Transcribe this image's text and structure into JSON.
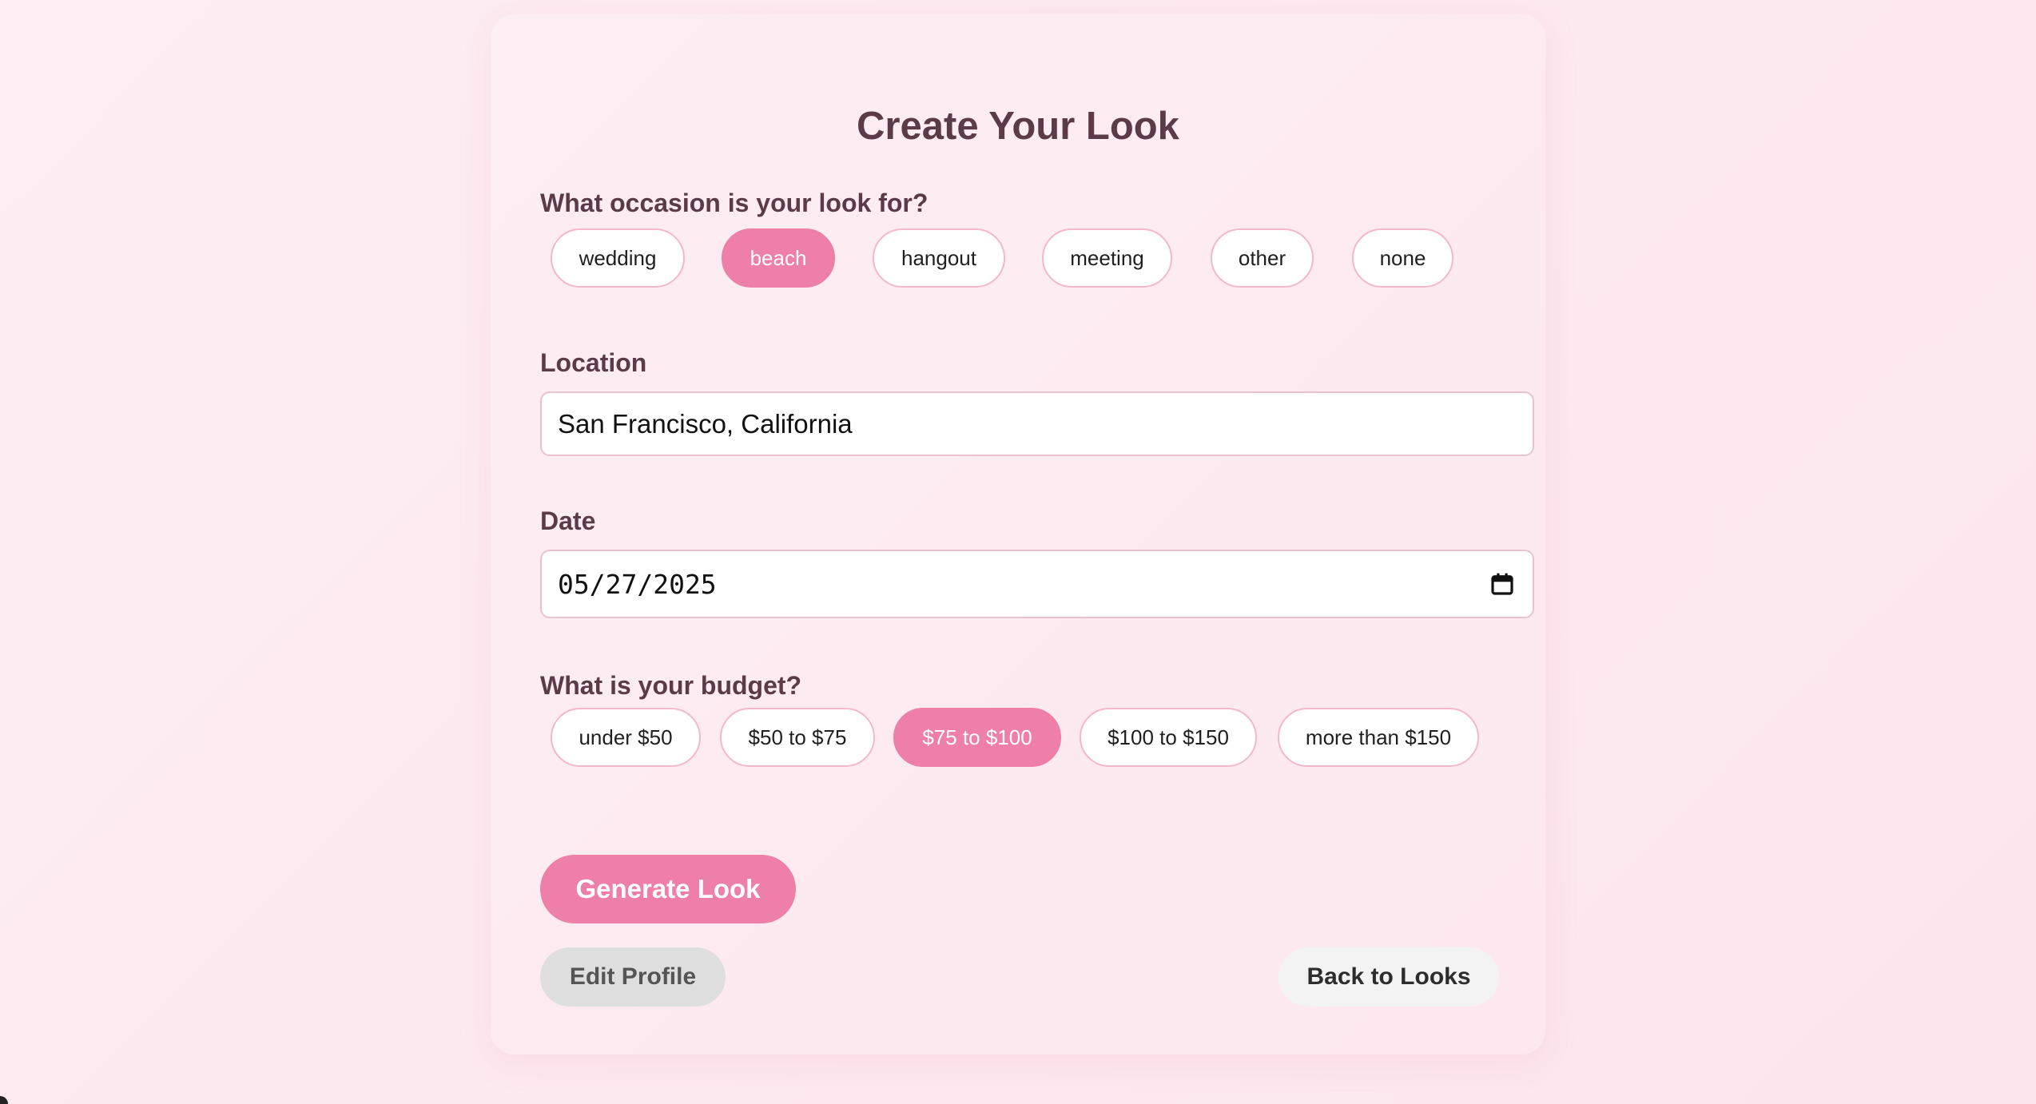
{
  "page": {
    "title": "Create Your Look"
  },
  "occasion": {
    "label": "What occasion is your look for?",
    "options": [
      "wedding",
      "beach",
      "hangout",
      "meeting",
      "other",
      "none"
    ],
    "selected": "beach"
  },
  "location": {
    "label": "Location",
    "value": "San Francisco, California"
  },
  "date": {
    "label": "Date",
    "value": "05/27/2025",
    "icon": "calendar-icon"
  },
  "budget": {
    "label": "What is your budget?",
    "options": [
      "under $50",
      "$50 to $75",
      "$75 to $100",
      "$100 to $150",
      "more than $150"
    ],
    "selected": "$75 to $100"
  },
  "actions": {
    "generate_label": "Generate Look",
    "edit_profile_label": "Edit Profile",
    "back_label": "Back to Looks"
  },
  "colors": {
    "accent": "#ee7fa7",
    "heading": "#5a3b47",
    "pill_border": "#f3b8cb"
  }
}
